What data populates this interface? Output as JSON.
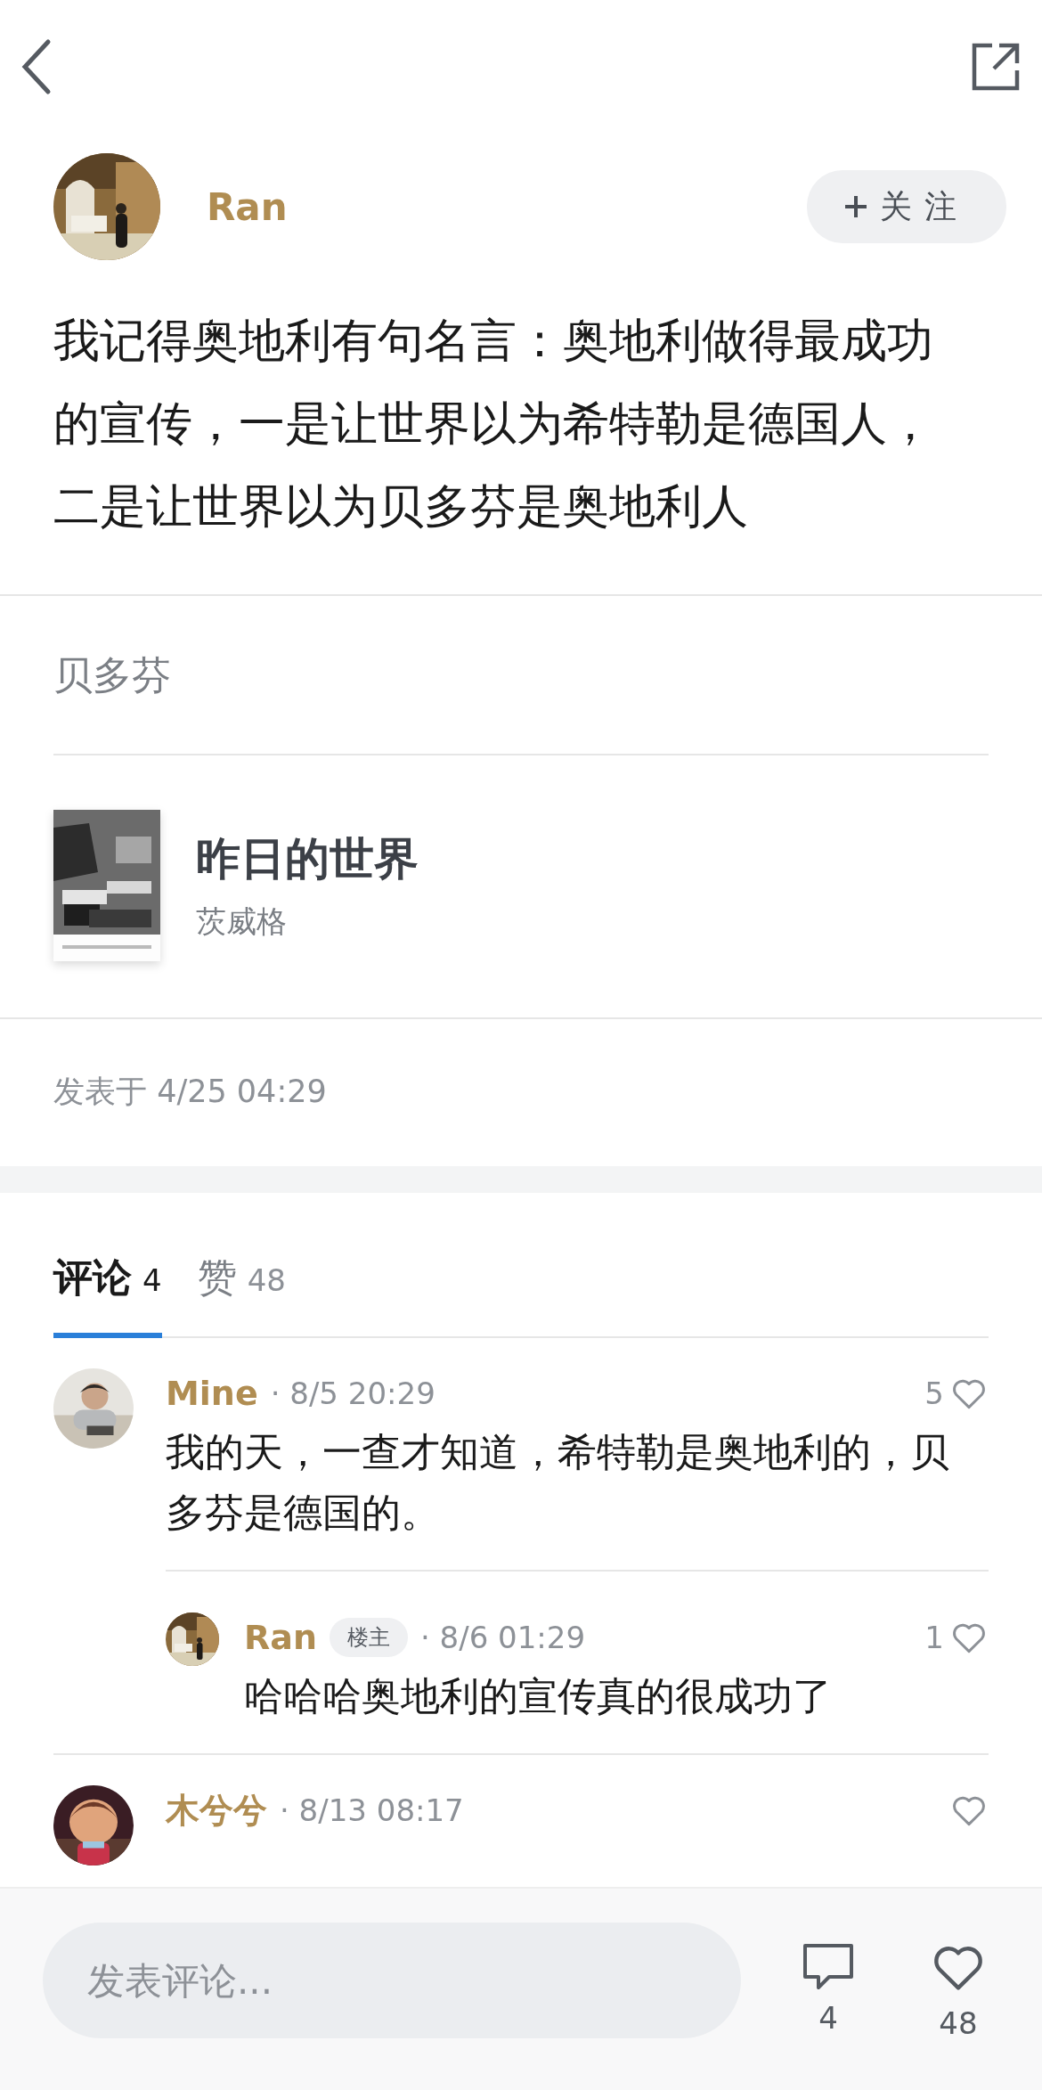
{
  "author": {
    "name": "Ran",
    "follow_button": "关注"
  },
  "post": {
    "text": "我记得奥地利有句名言：奥地利做得最成功的宣传，一是让世界以为希特勒是德国人，二是让世界以为贝多芬是奥地利人",
    "topic": "贝多芬",
    "book": {
      "title": "昨日的世界",
      "author": "茨威格"
    },
    "posted": "发表于 4/25 04:29"
  },
  "tabs": [
    {
      "label": "评论",
      "count": "4",
      "selected": true
    },
    {
      "label": "赞",
      "count": "48",
      "selected": false
    }
  ],
  "comments": [
    {
      "name": "Mine",
      "time": "· 8/5 20:29",
      "likes": "5",
      "text": "我的天，一查才知道，希特勒是奥地利的，贝多芬是德国的。",
      "replies": [
        {
          "name": "Ran",
          "badge": "楼主",
          "time": "· 8/6 01:29",
          "likes": "1",
          "text": "哈哈哈奥地利的宣传真的很成功了"
        }
      ]
    },
    {
      "name": "木兮兮",
      "time": "· 8/13 08:17"
    }
  ],
  "bottom_bar": {
    "placeholder": "发表评论...",
    "comment_count": "4",
    "like_count": "48"
  }
}
